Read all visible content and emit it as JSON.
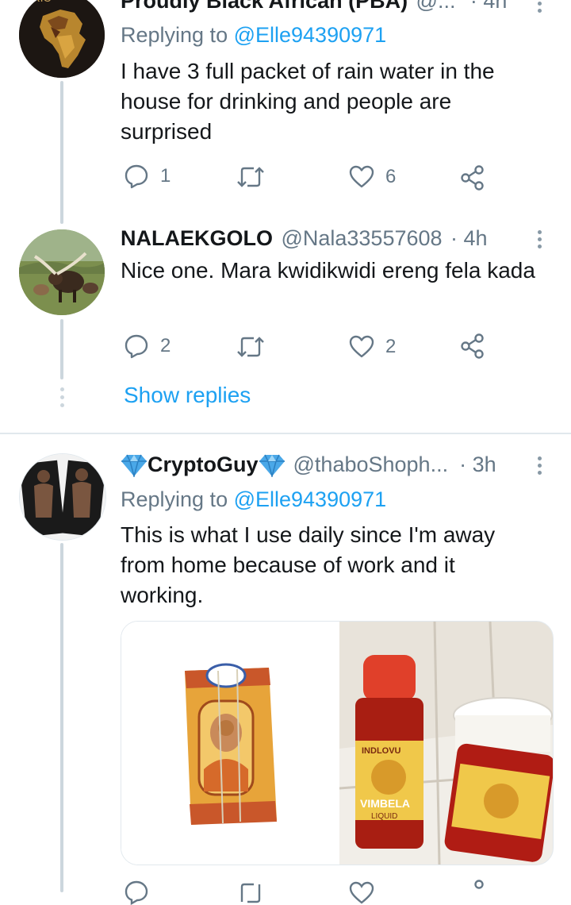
{
  "tweets": [
    {
      "name": "Proudly Black African (PBA)",
      "handle": "@...",
      "time": "· 4h",
      "replying_prefix": "Replying to ",
      "replying_handle": "@Elle94390971",
      "text": "I have 3 full packet of rain water in the house for drinking and people are surprised",
      "replies": "1",
      "retweets": "",
      "likes": "6"
    },
    {
      "name": "NALAEKGOLO",
      "handle": "@Nala33557608",
      "time": "· 4h",
      "text": "Nice one. Mara kwidikwidi ereng fela kada",
      "replies": "2",
      "retweets": "",
      "likes": "2"
    },
    {
      "name": "CryptoGuy",
      "handle": "@thaboShoph...",
      "time": "· 3h",
      "replying_prefix": "Replying to ",
      "replying_handle": "@Elle94390971",
      "text": "This is what I use daily since I'm away from home because of work and it working.",
      "media": [
        {
          "label_top": "INDLOVU",
          "label_main": "VIMBELA",
          "label_sub": "LIQUID"
        }
      ]
    }
  ],
  "show_replies": "Show replies",
  "colors": {
    "accent": "#1da1f2",
    "muted": "#657786",
    "thread": "#ccd6dd"
  }
}
